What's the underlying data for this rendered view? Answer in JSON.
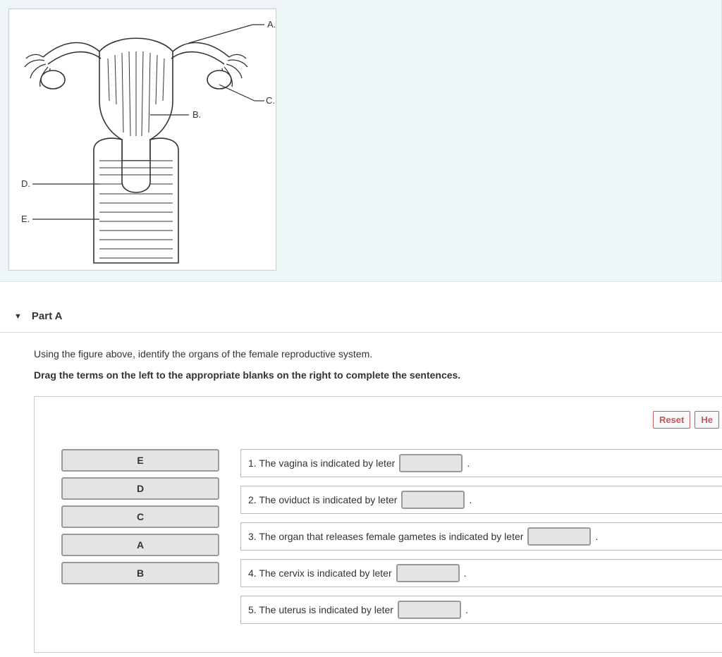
{
  "figure": {
    "labels": {
      "A": "A.",
      "B": "B.",
      "C": "C.",
      "D": "D.",
      "E": "E."
    }
  },
  "section": {
    "title": "Part A"
  },
  "instructions": {
    "line1": "Using the figure above, identify the organs of the female reproductive system.",
    "line2": "Drag the terms on the left to the appropriate blanks on the right to complete the sentences."
  },
  "buttons": {
    "reset": "Reset",
    "help": "He"
  },
  "terms": [
    "E",
    "D",
    "C",
    "A",
    "B"
  ],
  "sentences": [
    {
      "pre": "1. The vagina is indicated by leter",
      "post": "."
    },
    {
      "pre": "2. The oviduct is indicated by leter",
      "post": "."
    },
    {
      "pre": "3. The organ that releases female gametes is indicated by leter",
      "post": "."
    },
    {
      "pre": "4. The cervix is indicated by leter",
      "post": "."
    },
    {
      "pre": "5. The uterus is indicated by leter",
      "post": "."
    }
  ]
}
